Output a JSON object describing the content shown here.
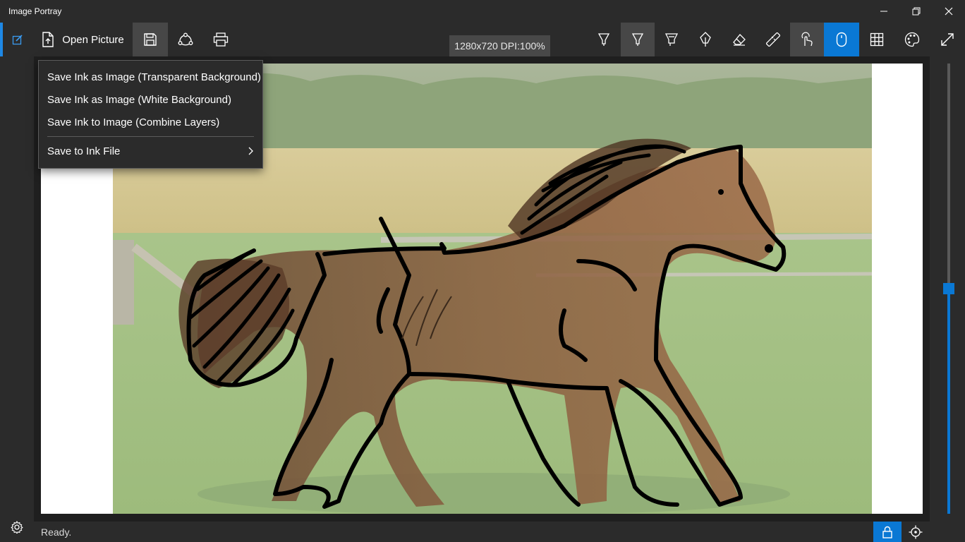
{
  "window": {
    "title": "Image Portray"
  },
  "toolbar": {
    "open_label": "Open Picture",
    "image_info": "1280x720 DPI:100%",
    "icons": [
      "edit-icon",
      "open-file-icon",
      "save-icon",
      "share-icon",
      "print-icon",
      "pen-1-icon",
      "pen-2-icon",
      "highlighter-icon",
      "calligraphy-pen-icon",
      "eraser-icon",
      "ruler-icon",
      "touch-icon",
      "mouse-icon",
      "grid-icon",
      "palette-icon",
      "fullscreen-icon"
    ],
    "accent_color": "#0a78d4",
    "pen_colors": [
      "#000000",
      "#000000",
      "#f5d800",
      "#000000"
    ]
  },
  "save_menu": {
    "items": [
      {
        "label": "Save Ink as Image (Transparent Background)"
      },
      {
        "label": "Save Ink as Image (White Background)"
      },
      {
        "label": "Save Ink to Image (Combine Layers)"
      },
      {
        "label": "Save to Ink File",
        "has_submenu": true
      }
    ]
  },
  "status": {
    "text": "Ready."
  },
  "zoom_slider": {
    "value_fraction": 0.5
  }
}
